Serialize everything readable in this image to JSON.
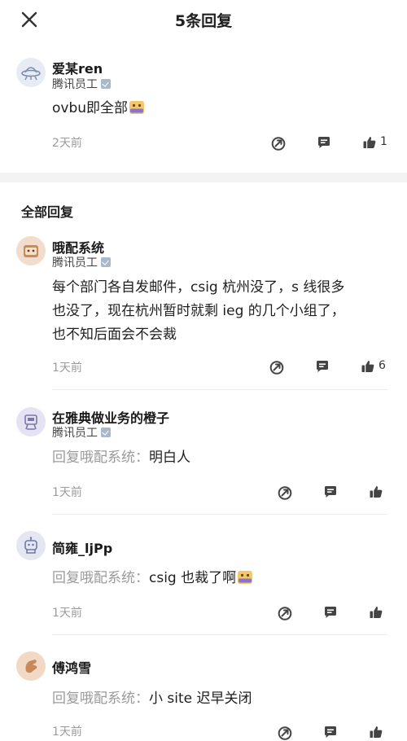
{
  "header": {
    "title": "5条回复"
  },
  "main_comment": {
    "author": "爱某ren",
    "role": "腾讯员工",
    "text": "ovbu即全部",
    "time": "2天前",
    "likes": "1"
  },
  "section": {
    "title": "全部回复"
  },
  "replies": [
    {
      "author": "哦配系统",
      "role": "腾讯员工",
      "text_lines": [
        "每个部门各自发邮件，csig 杭州没了，s 线很多",
        "也没了，现在杭州暂时就剩 ieg 的几个小组了，",
        "也不知后面会不会裁"
      ],
      "time": "1天前",
      "likes": "6"
    },
    {
      "author": "在雅典做业务的橙子",
      "role": "腾讯员工",
      "reply_prefix": "回复哦配系统：",
      "text": "明白人",
      "time": "1天前"
    },
    {
      "author": "简雍_ljPp",
      "reply_prefix": "回复哦配系统：",
      "text": "csig 也裁了啊",
      "time": "1天前"
    },
    {
      "author": "傅鸿雪",
      "reply_prefix": "回复哦配系统：",
      "text": "小 site 迟早关闭",
      "time": "1天前"
    }
  ],
  "colors": {
    "accent": "#4a4a4a",
    "muted": "#9b9b9b",
    "badge": "#a9b8cc",
    "gap": "#f3f3f3"
  },
  "icons": [
    "close-icon",
    "share-icon",
    "comment-icon",
    "thumbs-up-icon",
    "verified-badge-icon",
    "emoji-sticker-icon"
  ]
}
